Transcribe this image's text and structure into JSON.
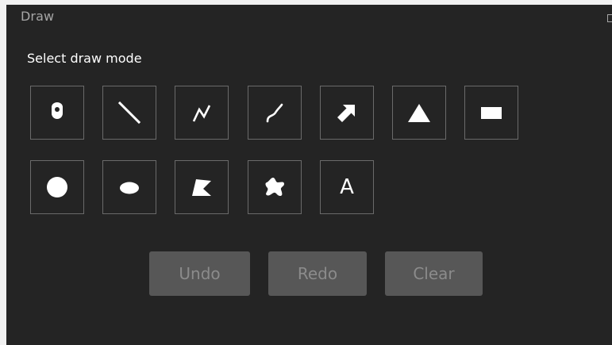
{
  "window": {
    "title": "Draw"
  },
  "prompt": {
    "label": "Select draw mode"
  },
  "tools": [
    {
      "name": "point",
      "icon": "point-pin-icon"
    },
    {
      "name": "line",
      "icon": "line-icon"
    },
    {
      "name": "polyline",
      "icon": "polyline-icon"
    },
    {
      "name": "freehand-polyline",
      "icon": "freehand-line-icon"
    },
    {
      "name": "arrow",
      "icon": "arrow-icon"
    },
    {
      "name": "triangle",
      "icon": "triangle-icon"
    },
    {
      "name": "rectangle",
      "icon": "rectangle-icon"
    },
    {
      "name": "circle",
      "icon": "circle-icon"
    },
    {
      "name": "ellipse",
      "icon": "ellipse-icon"
    },
    {
      "name": "polygon",
      "icon": "polygon-icon"
    },
    {
      "name": "freehand-polygon",
      "icon": "freehand-polygon-icon"
    },
    {
      "name": "text",
      "icon": "text-icon",
      "glyph": "A"
    }
  ],
  "actions": {
    "undo_label": "Undo",
    "redo_label": "Redo",
    "clear_label": "Clear"
  },
  "colors": {
    "panel_background": "#242424",
    "tile_border": "#6a6a6a",
    "disabled_button_bg": "#575757",
    "disabled_button_text": "#8b8b8b",
    "title_text": "#a6a6a6"
  }
}
